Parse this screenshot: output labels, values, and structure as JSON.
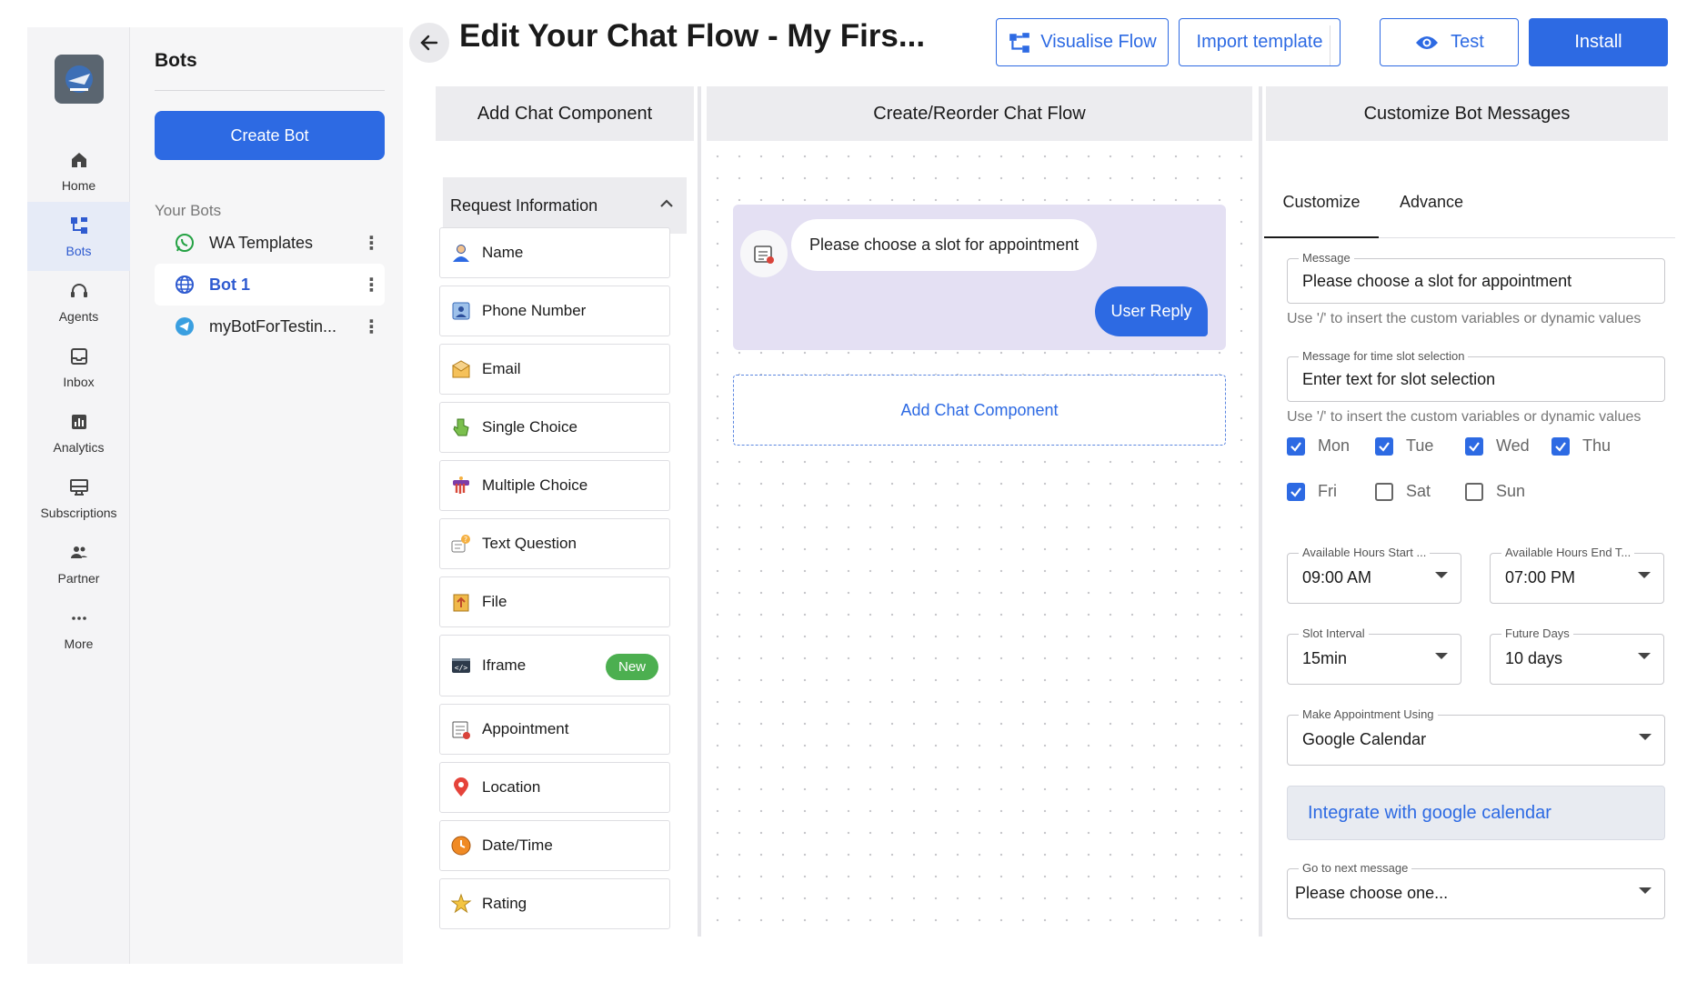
{
  "nav": {
    "items": [
      {
        "label": "Home",
        "icon": "home-icon"
      },
      {
        "label": "Bots",
        "icon": "bots-icon"
      },
      {
        "label": "Agents",
        "icon": "headset-icon"
      },
      {
        "label": "Inbox",
        "icon": "inbox-icon"
      },
      {
        "label": "Analytics",
        "icon": "analytics-icon"
      },
      {
        "label": "Subscriptions",
        "icon": "subscriptions-icon"
      },
      {
        "label": "Partner",
        "icon": "partner-icon"
      },
      {
        "label": "More",
        "icon": "more-icon"
      }
    ],
    "active": "Bots"
  },
  "bots": {
    "title": "Bots",
    "create_label": "Create Bot",
    "section_label": "Your Bots",
    "items": [
      {
        "name": "WA Templates",
        "icon": "whatsapp-icon"
      },
      {
        "name": "Bot 1",
        "icon": "globe-icon"
      },
      {
        "name": "myBotForTestin...",
        "icon": "telegram-icon"
      }
    ]
  },
  "header": {
    "title": "Edit Your Chat Flow - My Firs...",
    "visualise_label": "Visualise Flow",
    "import_label": "Import template",
    "test_label": "Test",
    "install_label": "Install"
  },
  "components": {
    "heading": "Add Chat Component",
    "group_label": "Request Information",
    "items": [
      {
        "label": "Name",
        "icon": "person-icon"
      },
      {
        "label": "Phone Number",
        "icon": "phone-card-icon"
      },
      {
        "label": "Email",
        "icon": "envelope-icon"
      },
      {
        "label": "Single Choice",
        "icon": "pointing-hand-icon"
      },
      {
        "label": "Multiple Choice",
        "icon": "multi-hand-icon"
      },
      {
        "label": "Text Question",
        "icon": "question-icon"
      },
      {
        "label": "File",
        "icon": "file-icon"
      },
      {
        "label": "Iframe",
        "icon": "code-icon"
      },
      {
        "label": "Appointment",
        "icon": "calendar-icon"
      },
      {
        "label": "Location",
        "icon": "location-pin-icon"
      },
      {
        "label": "Date/Time",
        "icon": "clock-icon"
      },
      {
        "label": "Rating",
        "icon": "star-icon"
      }
    ],
    "new_badge": "New"
  },
  "flow": {
    "heading": "Create/Reorder Chat Flow",
    "bot_message": "Please choose a slot for appointment",
    "user_reply": "User Reply",
    "add_label": "Add Chat Component"
  },
  "customize": {
    "heading": "Customize Bot Messages",
    "tabs": [
      "Customize",
      "Advance"
    ],
    "message_label": "Message",
    "message_value": "Please choose a slot for appointment",
    "hint": "Use '/' to insert the custom variables or dynamic values",
    "slot_label": "Message for time slot selection",
    "slot_value": "Enter text for slot selection",
    "days": [
      {
        "label": "Mon",
        "checked": true
      },
      {
        "label": "Tue",
        "checked": true
      },
      {
        "label": "Wed",
        "checked": true
      },
      {
        "label": "Thu",
        "checked": true
      },
      {
        "label": "Fri",
        "checked": true
      },
      {
        "label": "Sat",
        "checked": false
      },
      {
        "label": "Sun",
        "checked": false
      }
    ],
    "start_label": "Available Hours Start ...",
    "start_value": "09:00 AM",
    "end_label": "Available Hours End T...",
    "end_value": "07:00 PM",
    "interval_label": "Slot Interval",
    "interval_value": "15min",
    "future_label": "Future Days",
    "future_value": "10 days",
    "using_label": "Make Appointment Using",
    "using_value": "Google Calendar",
    "integrate_label": "Integrate with google calendar",
    "next_label": "Go to next message",
    "next_value": "Please choose one..."
  },
  "colors": {
    "accent": "#2d6ae3",
    "badge": "#4caf50",
    "flow_card": "#e4e0f3"
  }
}
